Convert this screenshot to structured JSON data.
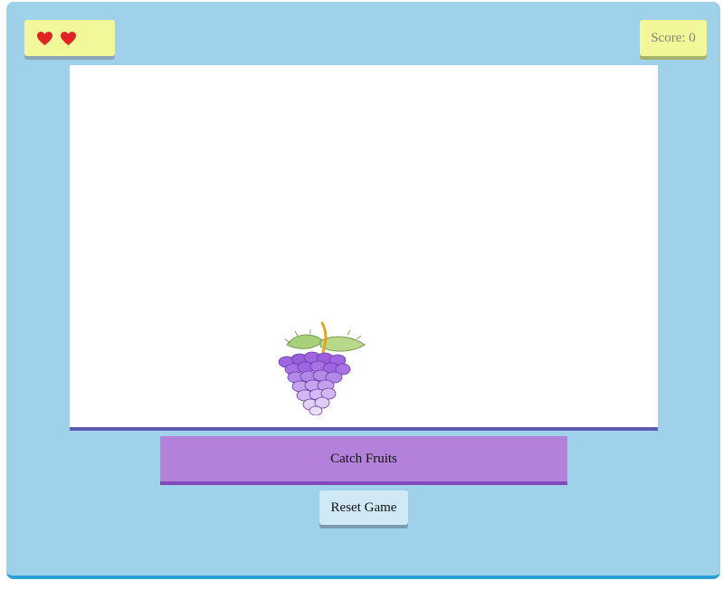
{
  "hud": {
    "lives": [
      "heart-icon",
      "heart-icon"
    ],
    "score_label": "Score:",
    "score_value": "0"
  },
  "game": {
    "falling_fruit": "grapes-icon"
  },
  "controls": {
    "catch_label": "Catch Fruits",
    "reset_label": "Reset Game"
  },
  "colors": {
    "frame": "#9fd2ea",
    "frame_border": "#2b9fd6",
    "hud_box": "#f2f79a",
    "heart": "#e02424",
    "catch_button": "#b381d9",
    "reset_button": "#cfe9f7",
    "grape": "#a065e0"
  }
}
